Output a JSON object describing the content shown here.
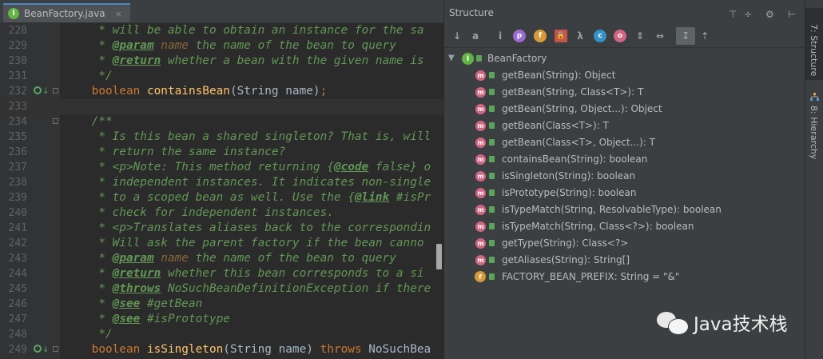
{
  "editor": {
    "tab": {
      "file_name": "BeanFactory.java",
      "close": "×",
      "icon_letter": "I"
    },
    "lines": [
      {
        "num": "228",
        "parts": [
          [
            "doc",
            "     * will be able to obtain an instance for the sa"
          ]
        ]
      },
      {
        "num": "229",
        "parts": [
          [
            "doc",
            "     * "
          ],
          [
            "tag",
            "@param"
          ],
          [
            "pn",
            " name"
          ],
          [
            "doc",
            " the name of the bean to query"
          ]
        ]
      },
      {
        "num": "230",
        "parts": [
          [
            "doc",
            "     * "
          ],
          [
            "tag",
            "@return"
          ],
          [
            "doc",
            " whether a bean with the given name is"
          ]
        ]
      },
      {
        "num": "231",
        "parts": [
          [
            "doc",
            "     */"
          ]
        ]
      },
      {
        "num": "232",
        "parts": [
          [
            "kw",
            "    boolean "
          ],
          [
            "fn",
            "containsBean"
          ],
          [
            "id",
            "(String name)"
          ],
          [
            "kw",
            ";"
          ]
        ],
        "impl": true
      },
      {
        "num": "233",
        "parts": [],
        "current": true
      },
      {
        "num": "234",
        "parts": [
          [
            "doc",
            "    /**"
          ]
        ],
        "fold": true
      },
      {
        "num": "235",
        "parts": [
          [
            "doc",
            "     * Is this bean a shared singleton? That is, will"
          ]
        ]
      },
      {
        "num": "236",
        "parts": [
          [
            "doc",
            "     * return the same instance?"
          ]
        ]
      },
      {
        "num": "237",
        "parts": [
          [
            "doc",
            "     * <p>Note: This method returning {"
          ],
          [
            "tag",
            "@code"
          ],
          [
            "doc",
            " false} o"
          ]
        ]
      },
      {
        "num": "238",
        "parts": [
          [
            "doc",
            "     * independent instances. It indicates non-single"
          ]
        ]
      },
      {
        "num": "239",
        "parts": [
          [
            "doc",
            "     * to a scoped bean as well. Use the {"
          ],
          [
            "tag",
            "@link"
          ],
          [
            "doc",
            " #isPr"
          ]
        ]
      },
      {
        "num": "240",
        "parts": [
          [
            "doc",
            "     * check for independent instances."
          ]
        ]
      },
      {
        "num": "241",
        "parts": [
          [
            "doc",
            "     * <p>Translates aliases back to the correspondin"
          ]
        ]
      },
      {
        "num": "242",
        "parts": [
          [
            "doc",
            "     * Will ask the parent factory if the bean canno"
          ]
        ]
      },
      {
        "num": "243",
        "parts": [
          [
            "doc",
            "     * "
          ],
          [
            "tag",
            "@param"
          ],
          [
            "pn",
            " name"
          ],
          [
            "doc",
            " the name of the bean to query"
          ]
        ]
      },
      {
        "num": "244",
        "parts": [
          [
            "doc",
            "     * "
          ],
          [
            "tag",
            "@return"
          ],
          [
            "doc",
            " whether this bean corresponds to a si"
          ]
        ]
      },
      {
        "num": "245",
        "parts": [
          [
            "doc",
            "     * "
          ],
          [
            "tag",
            "@throws"
          ],
          [
            "doc",
            " NoSuchBeanDefinitionException if there"
          ]
        ]
      },
      {
        "num": "246",
        "parts": [
          [
            "doc",
            "     * "
          ],
          [
            "tag",
            "@see"
          ],
          [
            "doc",
            " #getBean"
          ]
        ]
      },
      {
        "num": "247",
        "parts": [
          [
            "doc",
            "     * "
          ],
          [
            "tag",
            "@see"
          ],
          [
            "doc",
            " #isPrototype"
          ]
        ]
      },
      {
        "num": "248",
        "parts": [
          [
            "doc",
            "     */"
          ]
        ]
      },
      {
        "num": "249",
        "parts": [
          [
            "kw",
            "    boolean "
          ],
          [
            "fn",
            "isSingleton"
          ],
          [
            "id",
            "(String name) "
          ],
          [
            "kw",
            "throws "
          ],
          [
            "id",
            "NoSuchBea"
          ]
        ],
        "impl": true
      }
    ]
  },
  "structure": {
    "title": "Structure",
    "header_icons": [
      "align-icon",
      "split-icon",
      "gear-icon",
      "hide-icon"
    ],
    "toolbar": [
      {
        "name": "sort-by-visibility-icon",
        "glyph": "↓",
        "bg": "",
        "shape": "plain"
      },
      {
        "name": "sort-alphabetically-icon",
        "glyph": "a",
        "bg": "",
        "shape": "plain"
      },
      {
        "name": "show-inherited-icon",
        "glyph": "i",
        "bg": "",
        "shape": "plain"
      },
      {
        "name": "show-properties-icon",
        "glyph": "p",
        "bg": "#9b6bce",
        "shape": "circle"
      },
      {
        "name": "show-fields-icon",
        "glyph": "f",
        "bg": "#d69a3a",
        "shape": "circle"
      },
      {
        "name": "show-non-public-icon",
        "glyph": "🔒",
        "bg": "#c75450",
        "shape": "sq"
      },
      {
        "name": "show-lambdas-icon",
        "glyph": "λ",
        "bg": "",
        "shape": "plain"
      },
      {
        "name": "show-anonymous-icon",
        "glyph": "c",
        "bg": "#3592c4",
        "shape": "circle"
      },
      {
        "name": "show-enum-icon",
        "glyph": "o",
        "bg": "#d16582",
        "shape": "circle"
      },
      {
        "name": "expand-all-icon",
        "glyph": "⇕",
        "bg": "",
        "shape": "plain"
      },
      {
        "name": "collapse-all-icon",
        "glyph": "⇔",
        "bg": "",
        "shape": "plain"
      },
      {
        "name": "autoscroll-to-source-icon",
        "glyph": "↧",
        "bg": "",
        "shape": "pressed"
      },
      {
        "name": "autoscroll-from-source-icon",
        "glyph": "⇡",
        "bg": "",
        "shape": "plain"
      }
    ],
    "tree": {
      "root": "BeanFactory",
      "root_letter": "I",
      "items": [
        {
          "label": "getBean(String): Object",
          "kind": "m"
        },
        {
          "label": "getBean(String, Class<T>): T",
          "kind": "m"
        },
        {
          "label": "getBean(String, Object...): Object",
          "kind": "m"
        },
        {
          "label": "getBean(Class<T>): T",
          "kind": "m"
        },
        {
          "label": "getBean(Class<T>, Object...): T",
          "kind": "m"
        },
        {
          "label": "containsBean(String): boolean",
          "kind": "m"
        },
        {
          "label": "isSingleton(String): boolean",
          "kind": "m"
        },
        {
          "label": "isPrototype(String): boolean",
          "kind": "m"
        },
        {
          "label": "isTypeMatch(String, ResolvableType): boolean",
          "kind": "m"
        },
        {
          "label": "isTypeMatch(String, Class<?>): boolean",
          "kind": "m"
        },
        {
          "label": "getType(String): Class<?>",
          "kind": "m"
        },
        {
          "label": "getAliases(String): String[]",
          "kind": "m"
        },
        {
          "label": "FACTORY_BEAN_PREFIX: String = \"&\"",
          "kind": "f"
        }
      ]
    }
  },
  "strip": {
    "structure_tab": "7: Structure",
    "hierarchy_tab": "8: Hierarchy"
  },
  "watermark": {
    "text": "Java技术栈"
  }
}
